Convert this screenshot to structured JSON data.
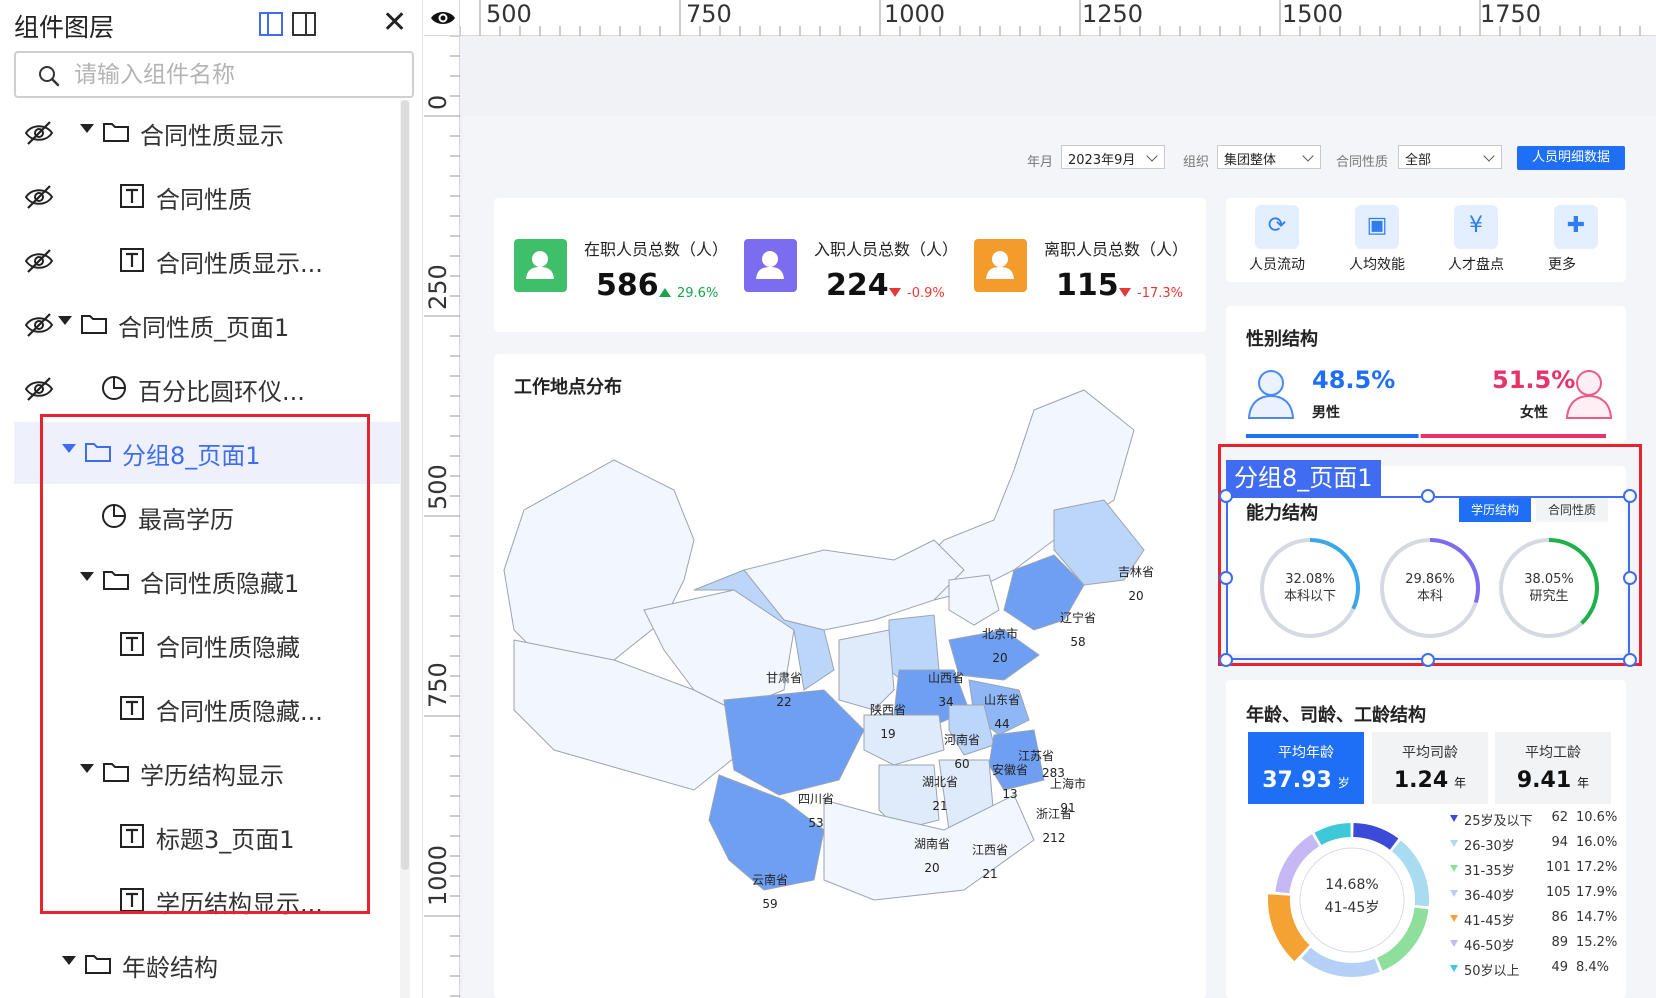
{
  "layer_panel": {
    "title": "组件图层",
    "search_placeholder": "请输入组件名称",
    "items": [
      {
        "label": "合同性质显示",
        "type": "folder",
        "hidden": true,
        "expanded": true
      },
      {
        "label": "合同性质",
        "type": "text",
        "hidden": true
      },
      {
        "label": "合同性质显示...",
        "type": "text",
        "hidden": true
      },
      {
        "label": "合同性质_页面1",
        "type": "folder",
        "hidden": true,
        "expanded": true
      },
      {
        "label": "百分比圆环仪...",
        "type": "pie",
        "hidden": true
      },
      {
        "label": "分组8_页面1",
        "type": "folder",
        "selected": true,
        "expanded": true
      },
      {
        "label": "最高学历",
        "type": "pie"
      },
      {
        "label": "合同性质隐藏1",
        "type": "folder",
        "expanded": true
      },
      {
        "label": "合同性质隐藏",
        "type": "text"
      },
      {
        "label": "合同性质隐藏...",
        "type": "text"
      },
      {
        "label": "学历结构显示",
        "type": "folder",
        "expanded": true
      },
      {
        "label": "标题3_页面1",
        "type": "text"
      },
      {
        "label": "学历结构显示...",
        "type": "text"
      },
      {
        "label": "年龄结构",
        "type": "folder",
        "expanded": true
      }
    ]
  },
  "rulers": {
    "top": [
      "500",
      "750",
      "1000",
      "1250",
      "1500",
      "1750"
    ],
    "left": [
      "0",
      "250",
      "500",
      "750",
      "1000"
    ]
  },
  "filters": {
    "month_label": "年月",
    "month_value": "2023年9月",
    "org_label": "组织",
    "org_value": "集团整体",
    "contract_label": "合同性质",
    "contract_value": "全部",
    "detail_button": "人员明细数据"
  },
  "kpis": [
    {
      "label": "在职人员总数（人）",
      "value": "586",
      "delta": "29.6%",
      "trend": "up",
      "color": "#3fbf6a"
    },
    {
      "label": "入职人员总数（人）",
      "value": "224",
      "delta": "-0.9%",
      "trend": "down",
      "color": "#7b6cf0"
    },
    {
      "label": "离职人员总数（人）",
      "value": "115",
      "delta": "-17.3%",
      "trend": "down",
      "color": "#f39c2c"
    }
  ],
  "quick_links": [
    {
      "label": "人员流动",
      "icon": "refresh-icon"
    },
    {
      "label": "人均效能",
      "icon": "user-card-icon"
    },
    {
      "label": "人才盘点",
      "icon": "yen-icon"
    },
    {
      "label": "更多",
      "icon": "grid-icon"
    }
  ],
  "map": {
    "title": "工作地点分布",
    "provinces": [
      {
        "name": "吉林省",
        "value": "20"
      },
      {
        "name": "辽宁省",
        "value": "58"
      },
      {
        "name": "北京市",
        "value": "20"
      },
      {
        "name": "甘肃省",
        "value": "22"
      },
      {
        "name": "山西省",
        "value": "34"
      },
      {
        "name": "山东省",
        "value": "44"
      },
      {
        "name": "陕西省",
        "value": "19"
      },
      {
        "name": "河南省",
        "value": "60"
      },
      {
        "name": "江苏省",
        "value": ""
      },
      {
        "name": "安徽省",
        "value": "13"
      },
      {
        "name": "上海市",
        "value": "91"
      },
      {
        "name": "湖北省",
        "value": "21"
      },
      {
        "name": "浙江省",
        "value": "212"
      },
      {
        "name": "四川省",
        "value": "53"
      },
      {
        "name": "湖南省",
        "value": "20"
      },
      {
        "name": "江西省",
        "value": "21"
      },
      {
        "name": "云南省",
        "value": "59"
      }
    ],
    "extra_label": "283"
  },
  "gender": {
    "title": "性别结构",
    "male_pct": "48.5%",
    "male_label": "男性",
    "female_pct": "51.5%",
    "female_label": "女性",
    "male_color": "#1e6ff5",
    "female_color": "#e8326a"
  },
  "ability": {
    "title": "能力结构",
    "tab_active": "学历结构",
    "tab_other": "合同性质",
    "rings": [
      {
        "pct": "32.08%",
        "label": "本科以下",
        "value": 0.3208,
        "color": "#3aa7e8"
      },
      {
        "pct": "29.86%",
        "label": "本科",
        "value": 0.2986,
        "color": "#7b6cf0"
      },
      {
        "pct": "38.05%",
        "label": "研究生",
        "value": 0.3805,
        "color": "#1fb24a"
      }
    ]
  },
  "selection": {
    "tag": "分组8_页面1"
  },
  "age": {
    "title": "年龄、司龄、工龄结构",
    "avgs": [
      {
        "title": "平均年龄",
        "value": "37.93",
        "unit": "岁",
        "active": true
      },
      {
        "title": "平均司龄",
        "value": "1.24",
        "unit": "年"
      },
      {
        "title": "平均工龄",
        "value": "9.41",
        "unit": "年"
      }
    ],
    "center_pct": "14.68%",
    "center_label": "41-45岁",
    "legend": [
      {
        "name": "25岁及以下",
        "count": "62",
        "pct": "10.6%",
        "value": 10.6,
        "color": "#3b4bd8"
      },
      {
        "name": "26-30岁",
        "count": "94",
        "pct": "16.0%",
        "value": 16.0,
        "color": "#a9dcf0"
      },
      {
        "name": "31-35岁",
        "count": "101",
        "pct": "17.2%",
        "value": 17.2,
        "color": "#8fdf9c"
      },
      {
        "name": "36-40岁",
        "count": "105",
        "pct": "17.9%",
        "value": 17.9,
        "color": "#b5d0f7"
      },
      {
        "name": "41-45岁",
        "count": "86",
        "pct": "14.7%",
        "value": 14.7,
        "color": "#f5a234"
      },
      {
        "name": "46-50岁",
        "count": "89",
        "pct": "15.2%",
        "value": 15.2,
        "color": "#c5b8f5"
      },
      {
        "name": "50岁以上",
        "count": "49",
        "pct": "8.4%",
        "value": 8.4,
        "color": "#3fc8d8"
      }
    ]
  }
}
